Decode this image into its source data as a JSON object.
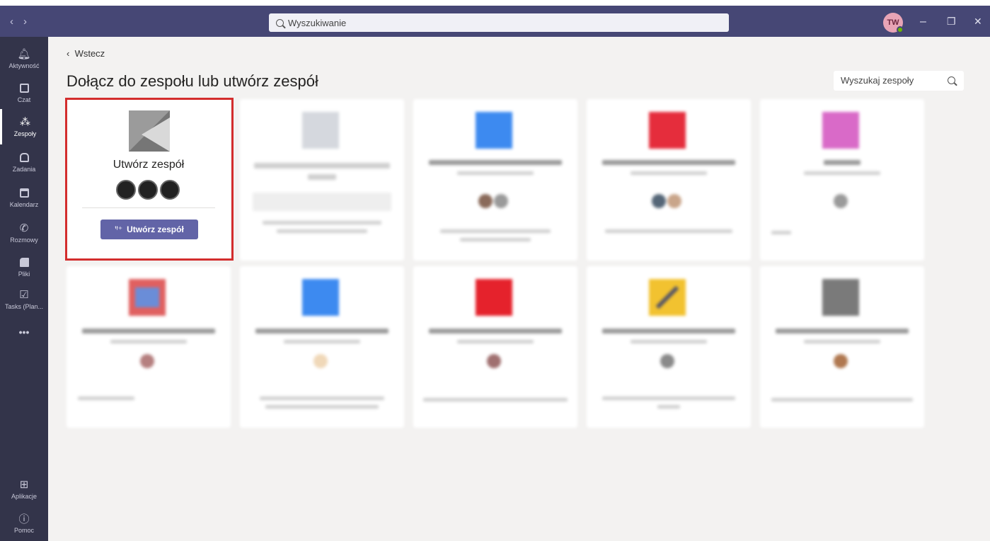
{
  "topbar": {
    "nav_back": "‹",
    "nav_forward": "›",
    "search_placeholder": "Wyszukiwanie",
    "user_initials": "TW",
    "window_minimize": "–",
    "window_restore": "❐",
    "window_close": "✕"
  },
  "rail": {
    "items": [
      {
        "label": "Aktywność",
        "icon": "bell-icon"
      },
      {
        "label": "Czat",
        "icon": "chat-icon"
      },
      {
        "label": "Zespoły",
        "icon": "teams-icon"
      },
      {
        "label": "Zadania",
        "icon": "assignments-icon"
      },
      {
        "label": "Kalendarz",
        "icon": "calendar-icon"
      },
      {
        "label": "Rozmowy",
        "icon": "phone-icon"
      },
      {
        "label": "Pliki",
        "icon": "files-icon"
      },
      {
        "label": "Tasks (Plan...",
        "icon": "tasks-icon"
      },
      {
        "label": "•••",
        "icon": "more-icon"
      },
      {
        "label": "Aplikacje",
        "icon": "apps-icon"
      },
      {
        "label": "Pomoc",
        "icon": "help-icon"
      }
    ],
    "active": "Zespoły"
  },
  "main": {
    "back_label": "Wstecz",
    "page_title": "Dołącz do zespołu lub utwórz zespół",
    "team_search_placeholder": "Wyszukaj zespoły",
    "create_card": {
      "title": "Utwórz zespół",
      "button_label": "Utwórz zespół"
    }
  },
  "colors": {
    "topbar": "#464775",
    "rail": "#33344a",
    "accent": "#6264a7",
    "highlight_border": "#d32d2d"
  }
}
